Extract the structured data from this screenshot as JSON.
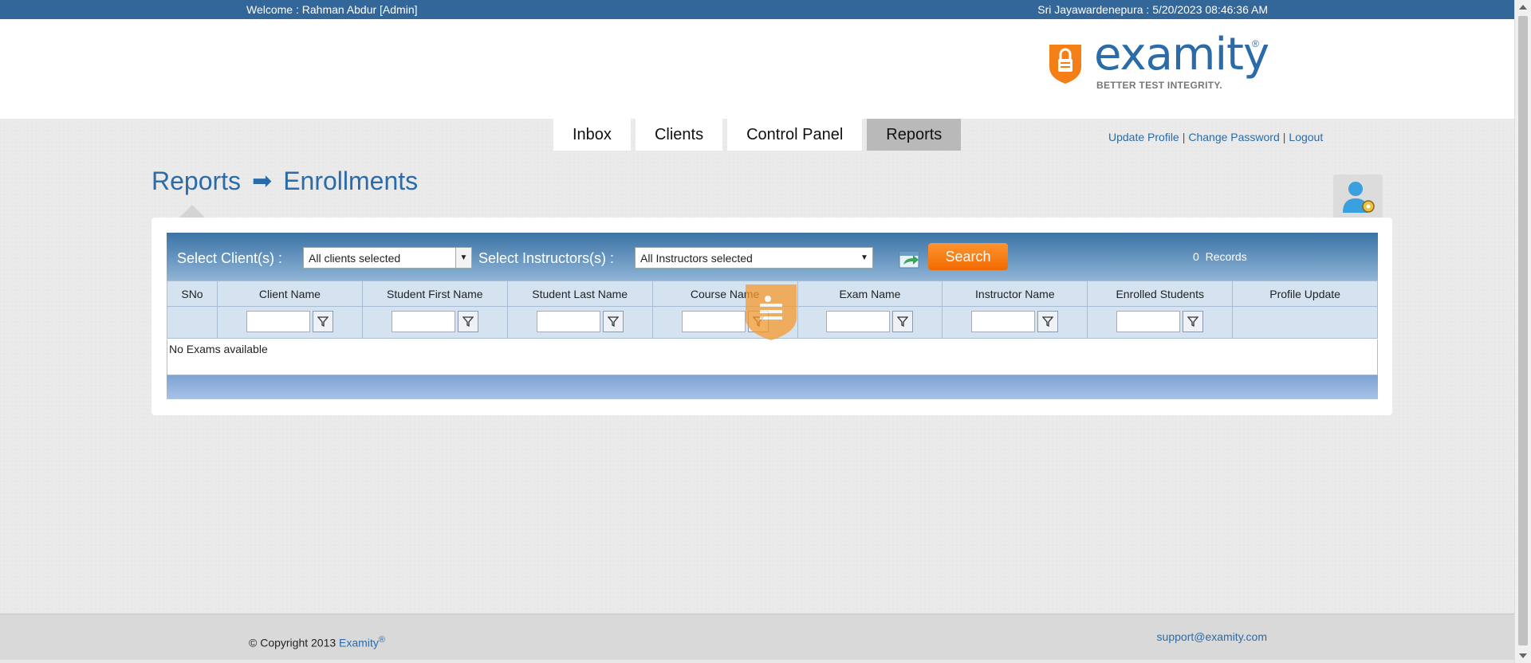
{
  "topbar": {
    "welcome": "Welcome : Rahman Abdur [Admin]",
    "clock": "Sri Jayawardenepura : 5/20/2023 08:46:36 AM"
  },
  "logo": {
    "word": "examity",
    "reg": "®",
    "tagline": "BETTER TEST INTEGRITY."
  },
  "nav": {
    "tabs": [
      {
        "label": "Inbox"
      },
      {
        "label": "Clients"
      },
      {
        "label": "Control Panel"
      },
      {
        "label": "Reports",
        "active": true
      }
    ]
  },
  "user_links": {
    "update_profile": "Update Profile",
    "change_password": "Change Password",
    "logout": "Logout",
    "separator": "|"
  },
  "page": {
    "section": "Reports",
    "subsection": "Enrollments"
  },
  "filters": {
    "client_label": "Select Client(s) :",
    "client_value": "All clients selected",
    "instructor_label": "Select Instructors(s) :",
    "instructor_value": "All Instructors selected",
    "search_label": "Search",
    "records_count": "0",
    "records_label": "Records"
  },
  "grid": {
    "columns": [
      "SNo",
      "Client Name",
      "Student First Name",
      "Student Last Name",
      "Course Name",
      "Exam Name",
      "Instructor Name",
      "Enrolled Students",
      "Profile Update"
    ],
    "empty_message": "No Exams available"
  },
  "footer": {
    "copyright": "© Copyright 2013 ",
    "brand": "Examity",
    "reg": "®",
    "support_email": "support@examity.com"
  },
  "colors": {
    "brand_blue": "#336699",
    "accent_orange": "#f47f16",
    "link_blue": "#2a6ba8"
  }
}
